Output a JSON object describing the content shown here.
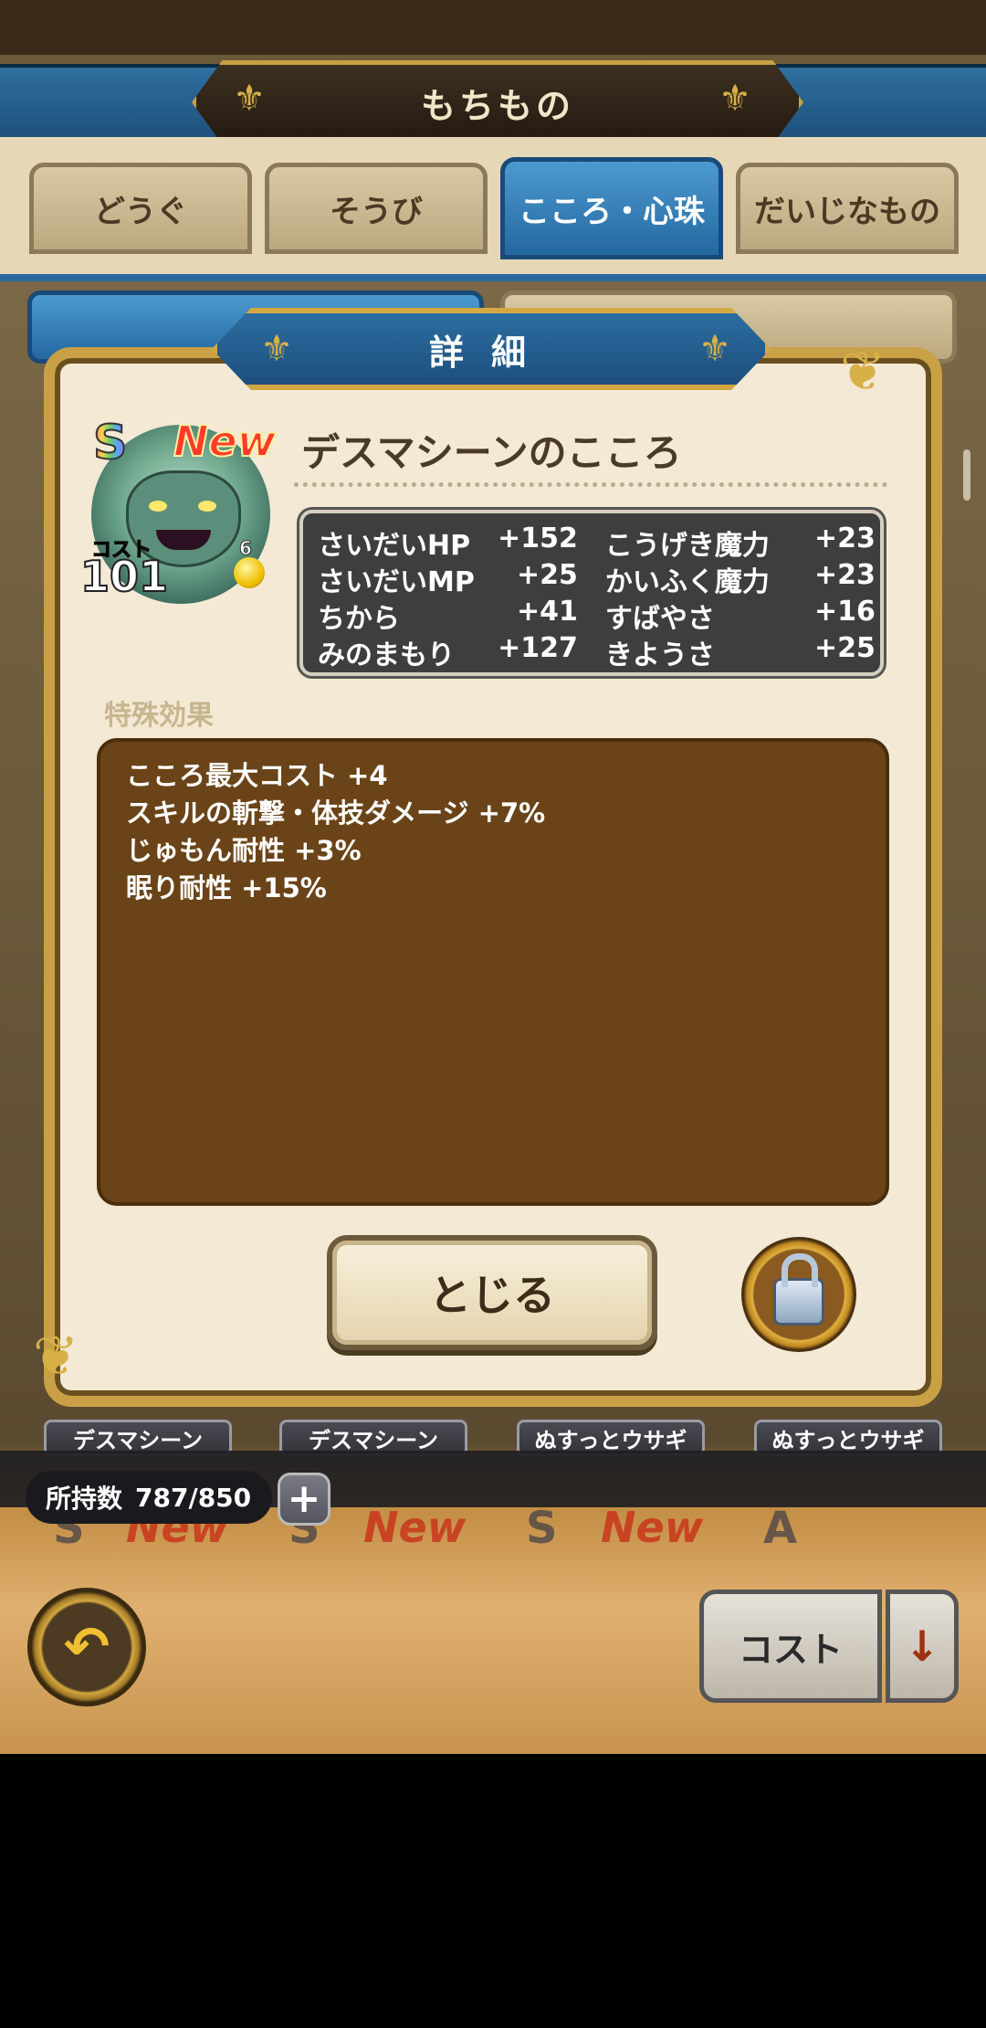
{
  "header": {
    "title": "もちもの"
  },
  "tabs": [
    {
      "label": "どうぐ",
      "active": false
    },
    {
      "label": "そうび",
      "active": false
    },
    {
      "label": "こころ・心珠",
      "active": true
    },
    {
      "label": "だいじなもの",
      "active": false
    }
  ],
  "dialog": {
    "title": "詳細",
    "item": {
      "rank": "S",
      "new_badge": "New",
      "name": "デスマシーンのこころ",
      "cost_label": "コスト",
      "cost": "101",
      "level": "6"
    },
    "stats": [
      {
        "name": "さいだいHP",
        "value": "+152",
        "name2": "こうげき魔力",
        "value2": "+23"
      },
      {
        "name": "さいだいMP",
        "value": "+25",
        "name2": "かいふく魔力",
        "value2": "+23"
      },
      {
        "name": "ちから",
        "value": "+41",
        "name2": "すばやさ",
        "value2": "+16"
      },
      {
        "name": "みのまもり",
        "value": "+127",
        "name2": "きようさ",
        "value2": "+25"
      }
    ],
    "special_label": "特殊効果",
    "effects": [
      "こころ最大コスト +4",
      "スキルの斬撃・体技ダメージ +7%",
      "じゅもん耐性 +3%",
      "眠り耐性 +15%"
    ],
    "close_label": "とじる",
    "lock_icon": "unlock-icon"
  },
  "list": {
    "names": [
      "デスマシーン",
      "デスマシーン",
      "ぬすっとウサギ",
      "ぬすっとウサギ"
    ],
    "ghost_ranks": [
      "S",
      "S",
      "S",
      "A"
    ],
    "ghost_new": [
      "New",
      "New",
      "New"
    ]
  },
  "footer": {
    "count_label": "所持数",
    "count_value": "787/850",
    "plus": "+",
    "sort_label": "コスト",
    "sort_arrow": "↓",
    "back_icon": "undo-icon"
  },
  "colors": {
    "accent_blue": "#2468a0",
    "gold": "#c9a045",
    "effects_bg": "#6a4418",
    "new_red": "#ff3a2a"
  }
}
